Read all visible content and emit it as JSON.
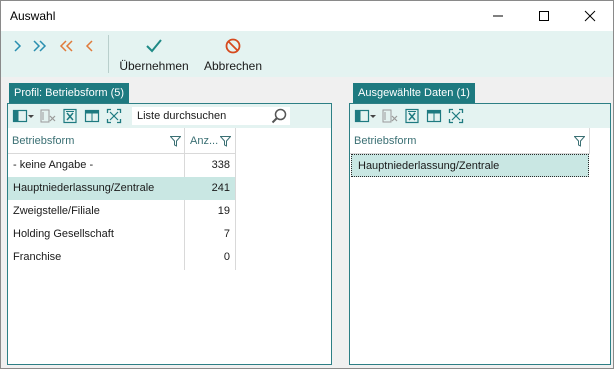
{
  "window": {
    "title": "Auswahl",
    "controls": [
      "minimize-icon",
      "maximize-icon",
      "close-icon"
    ]
  },
  "toolbar": {
    "nav_icons": [
      "chevron-right-icon",
      "double-chevron-right-icon",
      "double-chevron-left-icon",
      "chevron-left-icon"
    ],
    "apply_label": "Übernehmen",
    "cancel_label": "Abbrechen",
    "accent_color": "#1e7a80",
    "cancel_color": "#d64a1e"
  },
  "left_panel": {
    "tab_label": "Profil: Betriebsform (5)",
    "toolbar_icons": [
      "columns-icon",
      "dropdown-arrow-icon",
      "clear-filter-icon",
      "export-excel-icon",
      "layout-icon",
      "fit-columns-icon"
    ],
    "search": {
      "placeholder": "Liste durchsuchen",
      "icon": "search-icon"
    },
    "columns": [
      "Betriebsform",
      "Anz..."
    ],
    "rows": [
      {
        "name": "- keine Angabe -",
        "count": "338",
        "selected": false
      },
      {
        "name": "Hauptniederlassung/Zentrale",
        "count": "241",
        "selected": true
      },
      {
        "name": "Zweigstelle/Filiale",
        "count": "19",
        "selected": false
      },
      {
        "name": "Holding Gesellschaft",
        "count": "7",
        "selected": false
      },
      {
        "name": "Franchise",
        "count": "0",
        "selected": false
      }
    ]
  },
  "right_panel": {
    "tab_label": "Ausgewählte Daten (1)",
    "toolbar_icons": [
      "columns-icon",
      "dropdown-arrow-icon",
      "clear-filter-icon",
      "export-excel-icon",
      "layout-icon",
      "fit-columns-icon"
    ],
    "columns": [
      "Betriebsform"
    ],
    "rows": [
      {
        "name": "Hauptniederlassung/Zentrale",
        "selected": true
      }
    ]
  }
}
